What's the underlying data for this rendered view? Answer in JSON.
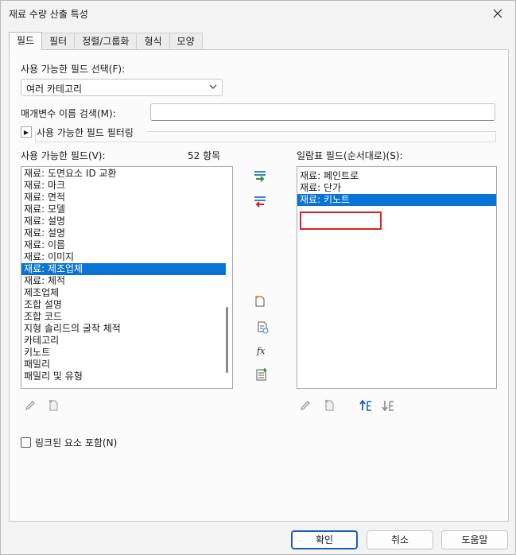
{
  "window": {
    "title": "재료 수량 산출 특성"
  },
  "tabs": [
    "필드",
    "필터",
    "정렬/그룹화",
    "형식",
    "모양"
  ],
  "fields": {
    "available_from_label": "사용 가능한 필드 선택(F):",
    "available_from_value": "여러 카테고리",
    "param_search_label": "매개변수 이름 검색(M):",
    "param_search_value": "",
    "filter_expander_label": "사용 가능한 필드 필터링",
    "available_label": "사용 가능한 필드(V):",
    "available_count": "52 항목",
    "available_items": [
      "재료: 도면요소 ID 교환",
      "재료: 마크",
      "재료: 면적",
      "재료: 모델",
      "재료: 설명",
      "재료: 설명",
      "재료: 이름",
      "재료: 이미지",
      "재료: 제조업체",
      "재료: 체적",
      "제조업체",
      "조합 설명",
      "조합 코드",
      "지형 솔리드의 굴착 체적",
      "카테고리",
      "키노트",
      "패밀리",
      "패밀리 및 유형"
    ],
    "available_selected_index": 8,
    "scheduled_label": "일람표 필드(순서대로)(S):",
    "scheduled_items": [
      "재료: 페인트로",
      "재료: 단가",
      "재료: 키노트"
    ],
    "scheduled_selected_index": 2,
    "include_linked_label": "링크된 요소 포함(N)",
    "include_linked_checked": false
  },
  "buttons": {
    "ok": "확인",
    "cancel": "취소",
    "help": "도움말"
  }
}
